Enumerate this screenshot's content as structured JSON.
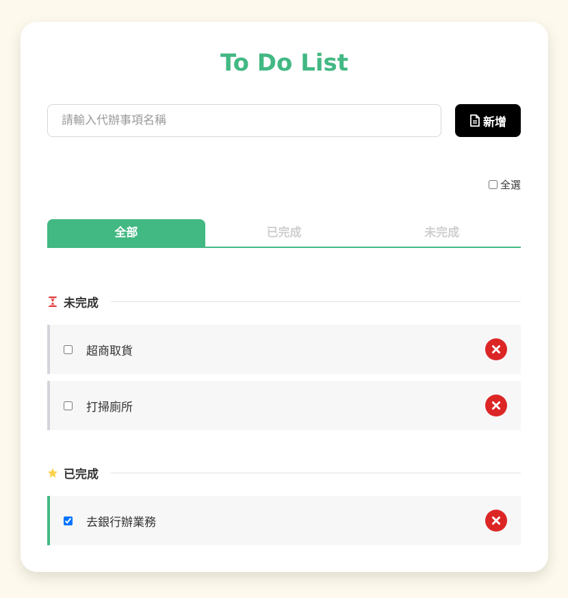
{
  "app": {
    "title": "To Do List"
  },
  "input": {
    "placeholder": "請輸入代辦事項名稱",
    "value": ""
  },
  "add_button": {
    "label": "新增",
    "icon": "file-icon"
  },
  "select_all": {
    "label": "全選",
    "checked": false
  },
  "tabs": [
    {
      "label": "全部",
      "active": true
    },
    {
      "label": "已完成",
      "active": false
    },
    {
      "label": "未完成",
      "active": false
    }
  ],
  "sections": {
    "pending": {
      "label": "未完成",
      "icon": "hourglass-icon",
      "items": [
        {
          "text": "超商取貨",
          "checked": false
        },
        {
          "text": "打掃廁所",
          "checked": false
        }
      ]
    },
    "done": {
      "label": "已完成",
      "icon": "star-icon",
      "items": [
        {
          "text": "去銀行辦業務",
          "checked": true
        }
      ]
    }
  },
  "colors": {
    "accent": "#42b883",
    "delete": "#dc2626",
    "background": "#fdf9ec",
    "star": "#fcd34d",
    "hourglass": "#dc2626"
  }
}
